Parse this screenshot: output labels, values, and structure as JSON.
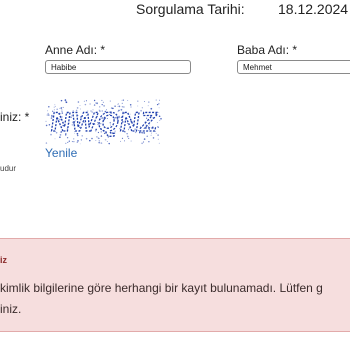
{
  "header": {
    "query_date_label": "Sorgulama Tarihi:",
    "query_date_value": "18.12.2024 1"
  },
  "form": {
    "mother_name": {
      "label": "Anne Adı: *",
      "value": "Habibe"
    },
    "father_name": {
      "label": "Baba Adı: *",
      "value": "Mehmet"
    },
    "captcha": {
      "label": "iniz: *",
      "code": "NWQNZ",
      "refresh_label": "Yenile"
    },
    "required_note": "udur"
  },
  "alert": {
    "title": "iz",
    "message_line1": "kimlik bilgilerine göre herhangi bir kayıt bulunamadı. Lütfen g",
    "message_line2": "iniz."
  },
  "colors": {
    "link": "#2f6db5",
    "captcha_ink": "#1f3fae",
    "alert_bg": "#f6dede",
    "alert_border": "#e2aaaa"
  }
}
